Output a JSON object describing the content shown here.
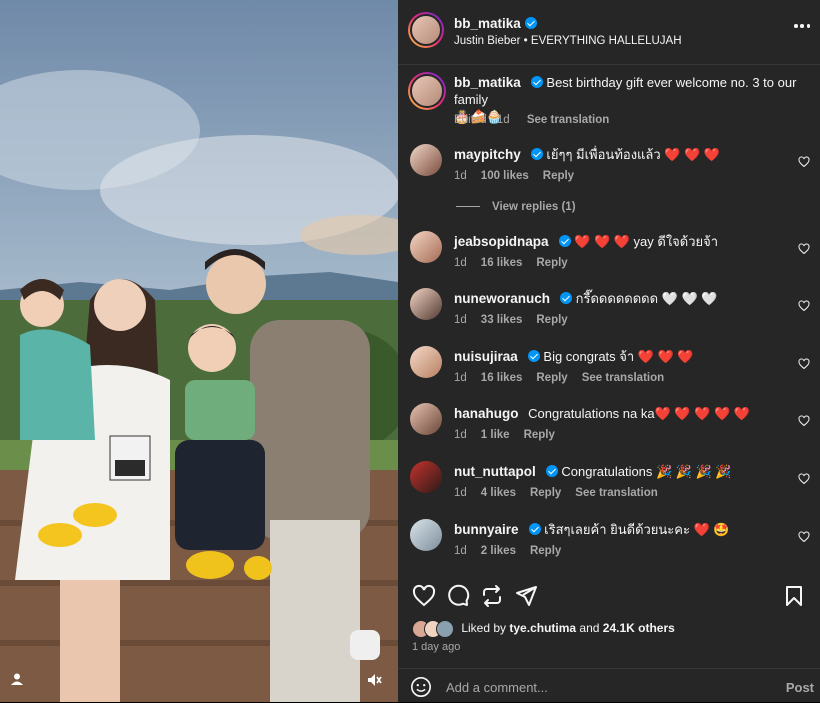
{
  "header": {
    "username": "bb_matika",
    "audio": "Justin Bieber • EVERYTHING HALLELUJAH"
  },
  "caption": {
    "username": "bb_matika",
    "text": "Best birthday gift ever welcome no. 3 to our family",
    "emoji": "🎂🍰🧁",
    "edited": "Edited · 1d",
    "see_translation": "See translation"
  },
  "comments": [
    {
      "username": "maypitchy",
      "verified": true,
      "text": "เย้ๆๆ มีเพื่อนท้องแล้ว ❤️ ❤️ ❤️",
      "time": "1d",
      "likes": "100 likes",
      "reply": "Reply",
      "translation": ""
    },
    {
      "username": "jeabsopidnapa",
      "verified": true,
      "text": "❤️ ❤️ ❤️ yay ดีใจด้วยจ้า",
      "time": "1d",
      "likes": "16 likes",
      "reply": "Reply",
      "translation": ""
    },
    {
      "username": "nuneworanuch",
      "verified": true,
      "text": "กรี๊ดดดดดดดด 🤍 🤍 🤍",
      "time": "1d",
      "likes": "33 likes",
      "reply": "Reply",
      "translation": ""
    },
    {
      "username": "nuisujiraa",
      "verified": true,
      "text": "Big congrats จ้า ❤️ ❤️ ❤️",
      "time": "1d",
      "likes": "16 likes",
      "reply": "Reply",
      "translation": "See translation"
    },
    {
      "username": "hanahugo",
      "verified": false,
      "text": "Congratulations na ka❤️ ❤️ ❤️ ❤️ ❤️",
      "time": "1d",
      "likes": "1 like",
      "reply": "Reply",
      "translation": ""
    },
    {
      "username": "nut_nuttapol",
      "verified": true,
      "text": "Congratulations 🎉 🎉 🎉 🎉",
      "time": "1d",
      "likes": "4 likes",
      "reply": "Reply",
      "translation": "See translation"
    },
    {
      "username": "bunnyaire",
      "verified": true,
      "text": "เริสๆเลยค้า ยินดีด้วยนะคะ ❤️ 🤩",
      "time": "1d",
      "likes": "2 likes",
      "reply": "Reply",
      "translation": ""
    }
  ],
  "view_replies": "View replies (1)",
  "likes_line": {
    "prefix": "Liked by",
    "user": "tye.chutima",
    "middle": "and",
    "count": "24.1K others"
  },
  "timestamp": "1 day ago",
  "add_comment": {
    "placeholder": "Add a comment...",
    "post": "Post"
  },
  "colors": {
    "panel_bg": "#262626",
    "verified": "#0095f6",
    "muted": "#a8a8a8"
  },
  "icons": [
    "heart-icon",
    "comment-icon",
    "repost-icon",
    "share-icon",
    "save-icon",
    "emoji-icon",
    "more-icon",
    "user-tag-icon",
    "mute-icon"
  ]
}
